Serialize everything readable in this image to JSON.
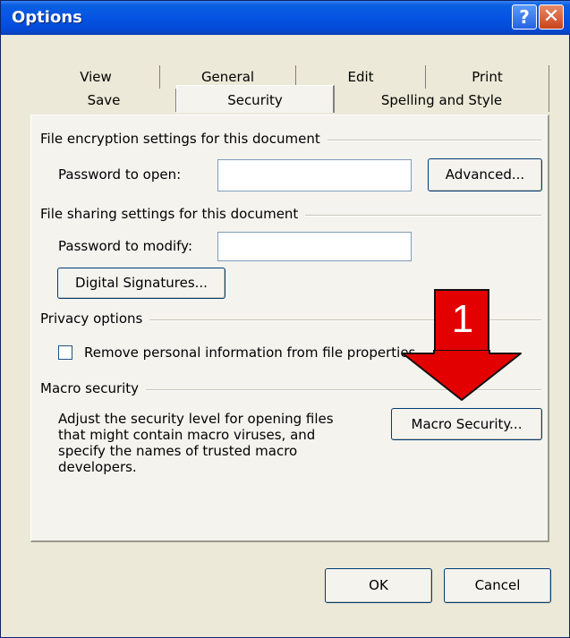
{
  "window": {
    "title": "Options",
    "help_glyph": "?",
    "close_glyph": "✕"
  },
  "tabs": {
    "row_back": [
      "View",
      "General",
      "Edit",
      "Print"
    ],
    "row_front": [
      "Save",
      "Security",
      "Spelling and Style"
    ],
    "active": "Security"
  },
  "encryption": {
    "heading": "File encryption settings for this document",
    "password_label": "Password to open:",
    "password_value": "",
    "advanced_label": "Advanced..."
  },
  "sharing": {
    "heading": "File sharing settings for this document",
    "password_label": "Password to modify:",
    "password_value": "",
    "signatures_label": "Digital Signatures..."
  },
  "privacy": {
    "heading": "Privacy options",
    "remove_info_label": "Remove personal information from file properties",
    "remove_info_checked": false
  },
  "macro": {
    "heading": "Macro security",
    "description_lines": [
      "Adjust the security level for opening files",
      "that might contain macro viruses, and",
      "specify the names of trusted macro",
      "developers."
    ],
    "button_label": "Macro Security..."
  },
  "footer": {
    "ok_label": "OK",
    "cancel_label": "Cancel"
  },
  "annotation": {
    "number": "1",
    "color": "#e30000",
    "icon": "down-arrow-icon"
  }
}
